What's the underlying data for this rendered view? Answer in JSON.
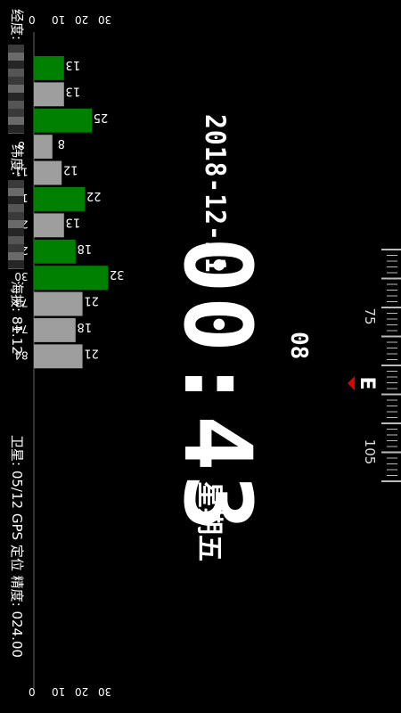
{
  "location": {
    "lon_label": "经度:",
    "lat_label": "纬度:",
    "alt_label": "海拔:",
    "altitude": "81.12"
  },
  "status": {
    "sat_label": "卫星:",
    "satellites": "05/12",
    "fix": "GPS 定位",
    "acc_label": "精度:",
    "accuracy": "024.00"
  },
  "clock": {
    "date": "2018-12-21",
    "time": "00:43",
    "seconds": "08",
    "weekday": "星期五"
  },
  "compass": {
    "heading_letter": "E",
    "labels": [
      "75",
      "105"
    ],
    "needle_color": "#e00000"
  },
  "chart_data": {
    "type": "bar",
    "categories": [
      "1",
      "3",
      "7",
      "8",
      "11",
      "17",
      "22",
      "28",
      "30",
      "73",
      "74",
      "84"
    ],
    "values": [
      13,
      13,
      25,
      8,
      12,
      22,
      13,
      18,
      32,
      21,
      18,
      21
    ],
    "used_in_fix": [
      true,
      false,
      true,
      false,
      false,
      true,
      false,
      true,
      true,
      false,
      false,
      false
    ],
    "y_ticks": [
      "0",
      "10",
      "20",
      "30"
    ],
    "ylim": [
      0,
      35
    ],
    "colors": {
      "used": "#008000",
      "unused": "#9e9e9e"
    }
  }
}
